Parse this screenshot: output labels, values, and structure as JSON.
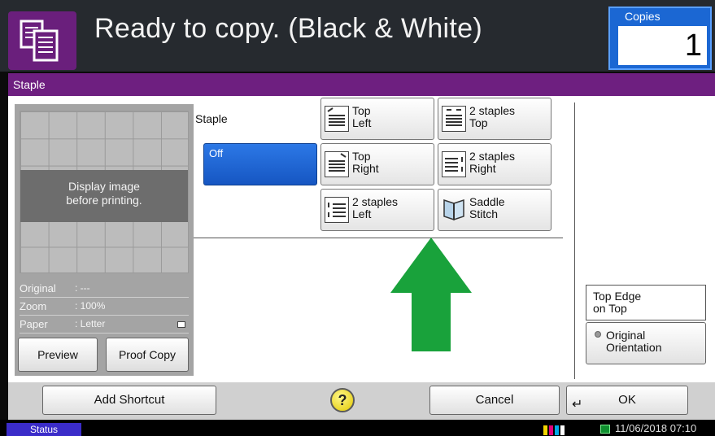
{
  "header": {
    "title": "Ready to copy. (Black & White)",
    "icon": "copy-document-icon",
    "copies_label": "Copies",
    "copies_value": "1"
  },
  "titlebar": {
    "title": "Staple"
  },
  "preview": {
    "message_line1": "Display image",
    "message_line2": "before printing.",
    "info": [
      {
        "label": "Original",
        "value": ": ---"
      },
      {
        "label": "Zoom",
        "value": ": 100%"
      },
      {
        "label": "Paper",
        "value": ": Letter"
      }
    ],
    "preview_label": "Preview",
    "proof_copy_label": "Proof Copy"
  },
  "staple": {
    "label": "Staple",
    "selected": "Off",
    "options": [
      {
        "label": "Top\nLeft",
        "icon": "staple-top-left-icon"
      },
      {
        "label": "2 staples\nTop",
        "icon": "staple-two-top-icon"
      },
      {
        "label": "Top\nRight",
        "icon": "staple-top-right-icon"
      },
      {
        "label": "2 staples\nRight",
        "icon": "staple-two-right-icon"
      },
      {
        "label": "2 staples\nLeft",
        "icon": "staple-two-left-icon"
      },
      {
        "label": "Saddle\nStitch",
        "icon": "saddle-stitch-icon"
      }
    ]
  },
  "orientation": {
    "current_line1": "Top Edge",
    "current_line2": "on Top",
    "button_line1": "Original",
    "button_line2": "Orientation"
  },
  "bottom": {
    "add_shortcut": "Add Shortcut",
    "help": "?",
    "cancel": "Cancel",
    "ok": "OK"
  },
  "status": {
    "status_label": "Status",
    "datetime": "11/06/2018  07:10"
  },
  "colors": {
    "header_bg": "#262a2f",
    "purple": "#6e1f80",
    "selected_blue": "#1b67d3",
    "arrow_green": "#19a23b"
  }
}
